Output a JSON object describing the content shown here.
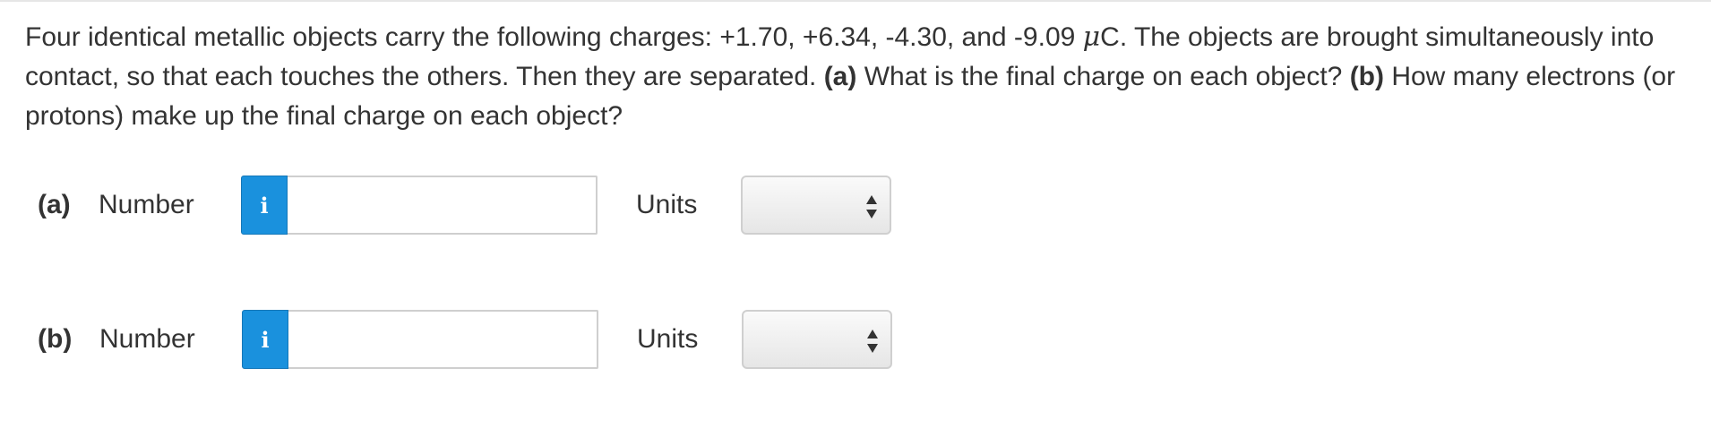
{
  "question": {
    "text_1": "Four identical metallic objects carry the following charges: +1.70, +6.34, -4.30, and -9.09 ",
    "mu_symbol": "μ",
    "text_2": "C. The objects are brought simultaneously into contact, so that each touches the others. Then they are separated. ",
    "part_a_marker": "(a)",
    "part_a_text": " What is the final charge on each object? ",
    "part_b_marker": "(b)",
    "part_b_text": " How many electrons (or protons) make up the final charge on each object?"
  },
  "answers": [
    {
      "part_label": "(a)",
      "number_label": "Number",
      "info_icon": "i",
      "number_value": "",
      "units_label": "Units",
      "units_selected": ""
    },
    {
      "part_label": "(b)",
      "number_label": "Number",
      "info_icon": "i",
      "number_value": "",
      "units_label": "Units",
      "units_selected": ""
    }
  ],
  "colors": {
    "info_button": "#1a91dd",
    "text": "#333333",
    "input_border": "#cfcfcf"
  }
}
